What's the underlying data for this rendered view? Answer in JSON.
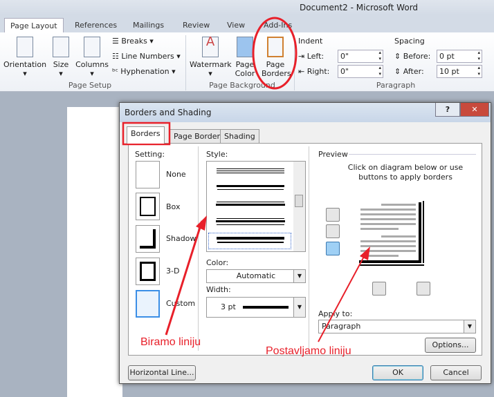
{
  "window": {
    "title": "Document2 - Microsoft Word"
  },
  "ribbon_tabs": [
    {
      "label": "Page Layout",
      "active": true
    },
    {
      "label": "References"
    },
    {
      "label": "Mailings"
    },
    {
      "label": "Review"
    },
    {
      "label": "View"
    },
    {
      "label": "Add-Ins"
    }
  ],
  "page_setup": {
    "orientation": "Orientation",
    "size": "Size",
    "columns": "Columns",
    "breaks": "Breaks",
    "line_numbers": "Line Numbers",
    "hyphenation": "Hyphenation",
    "group": "Page Setup"
  },
  "page_background": {
    "watermark": "Watermark",
    "page_color": "Page Color",
    "page_borders": "Page Borders",
    "group": "Page Background"
  },
  "paragraph": {
    "indent": "Indent",
    "left_label": "Left:",
    "left_value": "0\"",
    "right_label": "Right:",
    "right_value": "0\"",
    "spacing": "Spacing",
    "before_label": "Before:",
    "before_value": "0 pt",
    "after_label": "After:",
    "after_value": "10 pt",
    "group": "Paragraph"
  },
  "dialog": {
    "title": "Borders and Shading",
    "help": "?",
    "close": "✕",
    "tabs": [
      "Borders",
      "Page Border",
      "Shading"
    ],
    "setting_label": "Setting:",
    "settings": [
      "None",
      "Box",
      "Shadow",
      "3-D",
      "Custom"
    ],
    "style_label": "Style:",
    "color_label": "Color:",
    "color_value": "Automatic",
    "width_label": "Width:",
    "width_value": "3 pt",
    "preview_label": "Preview",
    "preview_hint": "Click on diagram below or use buttons to apply borders",
    "apply_label": "Apply to:",
    "apply_value": "Paragraph",
    "options": "Options...",
    "horizontal_line": "Horizontal Line...",
    "ok": "OK",
    "cancel": "Cancel"
  },
  "annotations": {
    "left": "Biramo liniju",
    "right": "Postavljamo liniju",
    "color": "#e8202a"
  }
}
